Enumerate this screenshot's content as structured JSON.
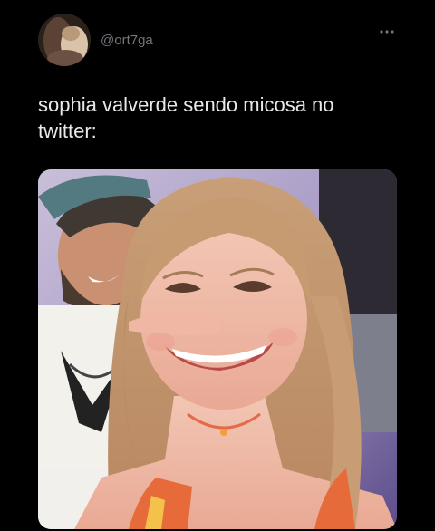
{
  "tweet": {
    "author": {
      "handle": "@ort7ga",
      "avatar_icon": "profile-avatar"
    },
    "more_icon": "ellipsis-icon",
    "text": "sophia valverde sendo micosa no\ntwitter:",
    "media": {
      "type": "photo",
      "icon": "selfie-photo"
    }
  },
  "colors": {
    "background": "#000000",
    "text": "#e7e9ea",
    "secondary": "#71767b"
  }
}
